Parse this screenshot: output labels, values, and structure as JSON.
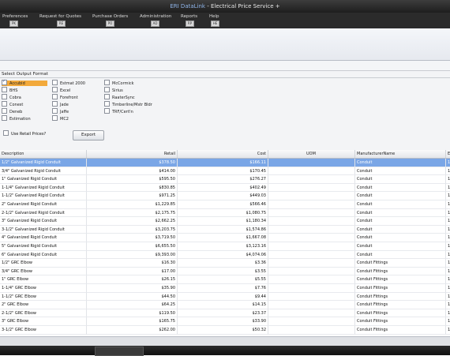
{
  "window": {
    "title_brand": "ERI DataLink",
    "title_rest": " - Electrical Price Service +"
  },
  "menu": [
    {
      "label": "Preferences",
      "key": "PK"
    },
    {
      "label": "Request for Quotes",
      "key": "RE"
    },
    {
      "label": "Purchase Orders",
      "key": "PO"
    },
    {
      "label": "Administration",
      "key": "AD"
    },
    {
      "label": "Reports",
      "key": "RP"
    },
    {
      "label": "Help",
      "key": "HE"
    }
  ],
  "output_format": {
    "title": "Select Output Format",
    "col1": [
      "Accubid",
      "BHS",
      "Cobra",
      "Conest",
      "Deneb",
      "Estimation"
    ],
    "col2": [
      "Estmat 2000",
      "Excel",
      "Forefront",
      "Jade",
      "Jaffe",
      "MC2"
    ],
    "col3": [
      "McCormick",
      "Sirius",
      "RaaterSync",
      "Timberline/Mstr Bldr",
      "TRF/Cert!n"
    ],
    "selected": "Accubid",
    "use_retail_label": "Use Retail Prices?",
    "export_label": "Export"
  },
  "grid": {
    "headers": {
      "description": "Description",
      "retail": "Retail",
      "cost": "Cost",
      "uom": "UOM",
      "manufacturer": "ManufacturerName",
      "extra": "E"
    },
    "rows": [
      {
        "description": "1/2\" Galvanized Rigid Conduit",
        "retail": "$378.50",
        "cost": "$166.11",
        "uom": "",
        "manufacturer": "Conduit",
        "extra": "1",
        "selected": true
      },
      {
        "description": "3/4\" Galvanized Rigid Conduit",
        "retail": "$414.00",
        "cost": "$170.45",
        "uom": "",
        "manufacturer": "Conduit",
        "extra": "1"
      },
      {
        "description": "1\" Galvanized Rigid Conduit",
        "retail": "$595.50",
        "cost": "$276.27",
        "uom": "",
        "manufacturer": "Conduit",
        "extra": "1"
      },
      {
        "description": "1-1/4\" Galvanized Rigid Conduit",
        "retail": "$830.85",
        "cost": "$402.49",
        "uom": "",
        "manufacturer": "Conduit",
        "extra": "1"
      },
      {
        "description": "1-1/2\" Galvanized Rigid Conduit",
        "retail": "$971.25",
        "cost": "$449.03",
        "uom": "",
        "manufacturer": "Conduit",
        "extra": "1"
      },
      {
        "description": "2\" Galvanized Rigid Conduit",
        "retail": "$1,229.85",
        "cost": "$566.46",
        "uom": "",
        "manufacturer": "Conduit",
        "extra": "1"
      },
      {
        "description": "2-1/2\" Galvanized Rigid Conduit",
        "retail": "$2,175.75",
        "cost": "$1,080.75",
        "uom": "",
        "manufacturer": "Conduit",
        "extra": "1"
      },
      {
        "description": "3\" Galvanized Rigid Conduit",
        "retail": "$2,662.25",
        "cost": "$1,180.34",
        "uom": "",
        "manufacturer": "Conduit",
        "extra": "1"
      },
      {
        "description": "3-1/2\" Galvanized Rigid Conduit",
        "retail": "$3,203.75",
        "cost": "$1,574.86",
        "uom": "",
        "manufacturer": "Conduit",
        "extra": "1"
      },
      {
        "description": "4\" Galvanized Rigid Conduit",
        "retail": "$3,719.50",
        "cost": "$1,667.08",
        "uom": "",
        "manufacturer": "Conduit",
        "extra": "1"
      },
      {
        "description": "5\" Galvanized Rigid Conduit",
        "retail": "$6,655.50",
        "cost": "$3,123.16",
        "uom": "",
        "manufacturer": "Conduit",
        "extra": "1"
      },
      {
        "description": "6\" Galvanized Rigid Conduit",
        "retail": "$9,393.00",
        "cost": "$4,074.06",
        "uom": "",
        "manufacturer": "Conduit",
        "extra": "1"
      },
      {
        "description": "1/2\" GRC Elbow",
        "retail": "$16.30",
        "cost": "$3.36",
        "uom": "",
        "manufacturer": "Conduit Fittings",
        "extra": "1"
      },
      {
        "description": "3/4\" GRC Elbow",
        "retail": "$17.00",
        "cost": "$3.55",
        "uom": "",
        "manufacturer": "Conduit Fittings",
        "extra": "1"
      },
      {
        "description": "1\" GRC Elbow",
        "retail": "$26.15",
        "cost": "$5.55",
        "uom": "",
        "manufacturer": "Conduit Fittings",
        "extra": "1"
      },
      {
        "description": "1-1/4\" GRC Elbow",
        "retail": "$35.90",
        "cost": "$7.76",
        "uom": "",
        "manufacturer": "Conduit Fittings",
        "extra": "1"
      },
      {
        "description": "1-1/2\" GRC Elbow",
        "retail": "$44.50",
        "cost": "$9.44",
        "uom": "",
        "manufacturer": "Conduit Fittings",
        "extra": "1"
      },
      {
        "description": "2\" GRC Elbow",
        "retail": "$64.25",
        "cost": "$14.15",
        "uom": "",
        "manufacturer": "Conduit Fittings",
        "extra": "1"
      },
      {
        "description": "2-1/2\" GRC Elbow",
        "retail": "$119.50",
        "cost": "$23.37",
        "uom": "",
        "manufacturer": "Conduit Fittings",
        "extra": "1"
      },
      {
        "description": "3\" GRC Elbow",
        "retail": "$165.75",
        "cost": "$33.90",
        "uom": "",
        "manufacturer": "Conduit Fittings",
        "extra": "1"
      },
      {
        "description": "3-1/2\" GRC Elbow",
        "retail": "$262.00",
        "cost": "$50.32",
        "uom": "",
        "manufacturer": "Conduit Fittings",
        "extra": "1"
      }
    ]
  },
  "colors": {
    "selection": "#7aa6e6",
    "checked_format": "#f2a93b",
    "title_brand": "#8fb4e8"
  }
}
